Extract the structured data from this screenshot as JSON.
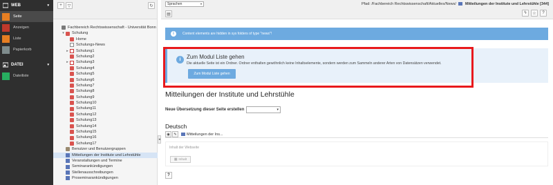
{
  "modules": {
    "web_group": "WEB",
    "web_items": [
      {
        "label": "Seite",
        "icon": "page-icon",
        "color": "#e67e22",
        "active": true
      },
      {
        "label": "Anzeigen",
        "icon": "eye-icon",
        "color": "#c0392b",
        "active": false
      },
      {
        "label": "Liste",
        "icon": "list-icon",
        "color": "#e67e22",
        "active": false
      },
      {
        "label": "Papierkorb",
        "icon": "trash-icon",
        "color": "#7f8c8d",
        "active": false
      }
    ],
    "file_group": "DATEI",
    "file_items": [
      {
        "label": "Dateiliste",
        "icon": "filelist-icon",
        "color": "#27ae60",
        "active": false
      }
    ]
  },
  "tree": {
    "nodes": [
      {
        "label": "Fachbereich Rechtswissenschaft - Universität Bonn",
        "level": 0,
        "icon": "root",
        "toggle": ""
      },
      {
        "label": "Schulung",
        "level": 1,
        "icon": "red",
        "toggle": "▾"
      },
      {
        "label": "Home",
        "level": 2,
        "icon": "red",
        "toggle": ""
      },
      {
        "label": "Schulungs-News",
        "level": 2,
        "icon": "page",
        "toggle": ""
      },
      {
        "label": "Schulung1",
        "level": 2,
        "icon": "pagered",
        "toggle": "▸"
      },
      {
        "label": "Schulung2",
        "level": 2,
        "icon": "red",
        "toggle": ""
      },
      {
        "label": "Schulung3",
        "level": 2,
        "icon": "pagered",
        "toggle": "▸"
      },
      {
        "label": "Schulung4",
        "level": 2,
        "icon": "red",
        "toggle": ""
      },
      {
        "label": "Schulung5",
        "level": 2,
        "icon": "red",
        "toggle": ""
      },
      {
        "label": "Schulung6",
        "level": 2,
        "icon": "red",
        "toggle": ""
      },
      {
        "label": "Schulung7",
        "level": 2,
        "icon": "red",
        "toggle": ""
      },
      {
        "label": "Schulung8",
        "level": 2,
        "icon": "red",
        "toggle": ""
      },
      {
        "label": "Schulung9",
        "level": 2,
        "icon": "red",
        "toggle": ""
      },
      {
        "label": "Schulung10",
        "level": 2,
        "icon": "red",
        "toggle": ""
      },
      {
        "label": "Schulung11",
        "level": 2,
        "icon": "red",
        "toggle": ""
      },
      {
        "label": "Schulung12",
        "level": 2,
        "icon": "red",
        "toggle": ""
      },
      {
        "label": "Schulung13",
        "level": 2,
        "icon": "red",
        "toggle": ""
      },
      {
        "label": "Schulung14",
        "level": 2,
        "icon": "red",
        "toggle": ""
      },
      {
        "label": "Schulung15",
        "level": 2,
        "icon": "red",
        "toggle": ""
      },
      {
        "label": "Schulung16",
        "level": 2,
        "icon": "red",
        "toggle": ""
      },
      {
        "label": "Schulung17",
        "level": 2,
        "icon": "red",
        "toggle": ""
      },
      {
        "label": "Benutzer und Benutzergruppen",
        "level": 1,
        "icon": "brown",
        "toggle": ""
      },
      {
        "label": "Mitteilungen der Institute und Lehrstühle",
        "level": 1,
        "icon": "blue",
        "toggle": "",
        "selected": true
      },
      {
        "label": "Veranstaltungen und Termine",
        "level": 1,
        "icon": "blue",
        "toggle": ""
      },
      {
        "label": "Seminarankündigungen",
        "level": 1,
        "icon": "blue",
        "toggle": ""
      },
      {
        "label": "Stellenausschreibungen",
        "level": 1,
        "icon": "blue",
        "toggle": ""
      },
      {
        "label": "Proseminarankündigungen",
        "level": 1,
        "icon": "blue",
        "toggle": ""
      }
    ]
  },
  "header": {
    "language_select": "Sprachen",
    "path_prefix": "Pfad: /Fachbereich Rechtswissenschaft/Aktuelles/News/",
    "path_title": "Mitteilungen der Institute und Lehrstühle [344]"
  },
  "notice": {
    "hidden_elements": "Content elements are hidden in sys folders of type \"news\"!"
  },
  "info_panel": {
    "title": "Zum Modul Liste gehen",
    "text": "Die aktuelle Seite ist ein Ordner. Ordner enthalten gewöhnlich keine Inhaltselemente, sondern werden zum Sammeln anderer Arten von Datensätzen verwendet.",
    "button": "Zum Modul Liste gehen"
  },
  "page": {
    "title": "Mitteilungen der Institute und Lehrstühle",
    "translation_label": "Neue Übersetzung dieser Seite erstellen",
    "language_heading": "Deutsch",
    "ce_title": "Mitteilungen der Ins...",
    "placeholder": "Inhalt der Webseite",
    "new_button": "Inhalt",
    "help": "?"
  },
  "colors": {
    "highlight_frame": "#e8191c",
    "accent_blue": "#6daae0",
    "menu_dark": "#2f2f2f"
  }
}
